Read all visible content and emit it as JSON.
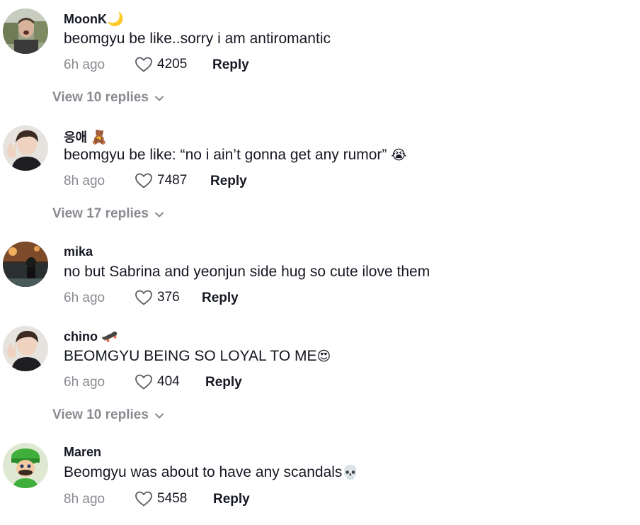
{
  "comments": [
    {
      "username": "MoonK",
      "username_emoji": "🌙",
      "text": "beomgyu be like..sorry i am antiromantic",
      "text_emoji": "",
      "time": "6h ago",
      "likes": "4205",
      "reply_label": "Reply",
      "view_replies": "View 10 replies"
    },
    {
      "username": "응애",
      "username_emoji": "🧸",
      "text": "beomgyu be like: “no i ain’t gonna get any rumor”",
      "text_emoji": "😭",
      "time": "8h ago",
      "likes": "7487",
      "reply_label": "Reply",
      "view_replies": "View 17 replies"
    },
    {
      "username": "mika",
      "username_emoji": "",
      "text": "no but Sabrina and yeonjun side hug so cute ilove them",
      "text_emoji": "",
      "time": "6h ago",
      "likes": "376",
      "reply_label": "Reply",
      "view_replies": ""
    },
    {
      "username": "chino",
      "username_emoji": "🛹",
      "text": "BEOMGYU BEING SO LOYAL TO ME",
      "text_emoji": "😍",
      "time": "6h ago",
      "likes": "404",
      "reply_label": "Reply",
      "view_replies": "View 10 replies"
    },
    {
      "username": "Maren",
      "username_emoji": "",
      "text": "Beomgyu was about to have any scandals",
      "text_emoji": "💀",
      "time": "8h ago",
      "likes": "5458",
      "reply_label": "Reply",
      "view_replies": ""
    }
  ],
  "icons": {
    "like": "heart-outline-icon",
    "expand": "chevron-down-icon"
  },
  "colors": {
    "primary_text": "#161823",
    "secondary_text": "#8a8b91"
  }
}
